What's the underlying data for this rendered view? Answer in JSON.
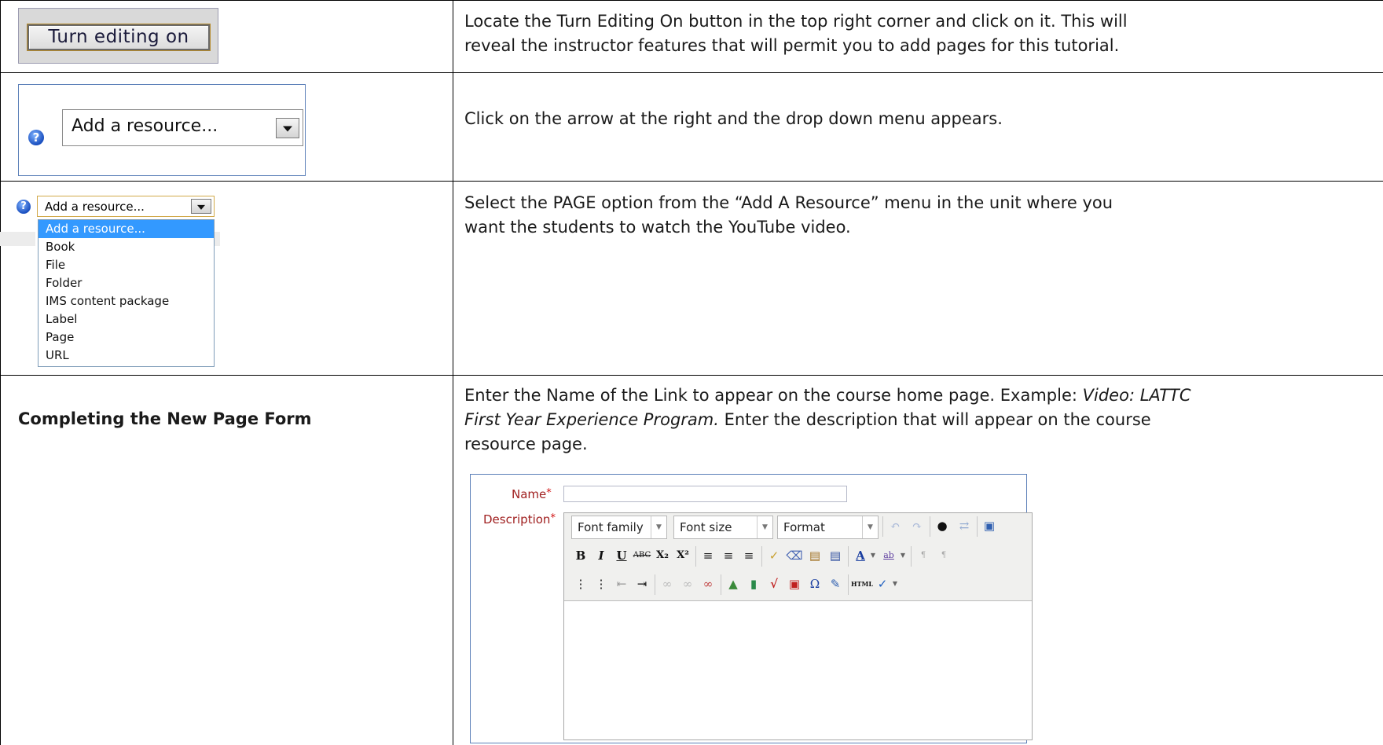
{
  "row1": {
    "button_label": "Turn editing on",
    "instruction_line1": "Locate the Turn Editing On button in the top right corner and click on it.  This will",
    "instruction_line2": "reveal the instructor features that will permit you to add pages for this tutorial."
  },
  "row2": {
    "help_icon": "help-question-icon",
    "select_label": "Add a resource...",
    "instruction": "Click on the arrow at the right and the drop down menu appears."
  },
  "row3": {
    "select_label": "Add a resource...",
    "options": [
      "Add a resource...",
      "Book",
      "File",
      "Folder",
      "IMS content package",
      "Label",
      "Page",
      "URL"
    ],
    "selected_option": "Add a resource...",
    "instruction_line1": "Select the PAGE option from the “Add A Resource” menu in the unit where you",
    "instruction_line2": "want the students to watch the YouTube video."
  },
  "row4": {
    "heading": "Completing the New Page Form",
    "instruction_line1_a": "Enter the Name of the Link to appear on the course home page.  Example: ",
    "instruction_line1_b": "Video: LATTC",
    "instruction_line2_a": "First Year Experience Program.",
    "instruction_line2_b": "  Enter the description that will appear on the course",
    "instruction_line3": "resource page.",
    "form": {
      "name_label": "Name",
      "description_label": "Description",
      "required_mark": "*",
      "font_family": "Font family",
      "font_size": "Font size",
      "format": "Format",
      "toolbar_row2": [
        "B",
        "I",
        "U",
        "ABC",
        "X₂",
        "X²"
      ],
      "omega": "Ω",
      "html_label": "HTML"
    }
  },
  "colors": {
    "grid": "#000000",
    "frame_blue": "#5b7fb8",
    "selection": "#3399ff",
    "required_red": "#d01010"
  }
}
